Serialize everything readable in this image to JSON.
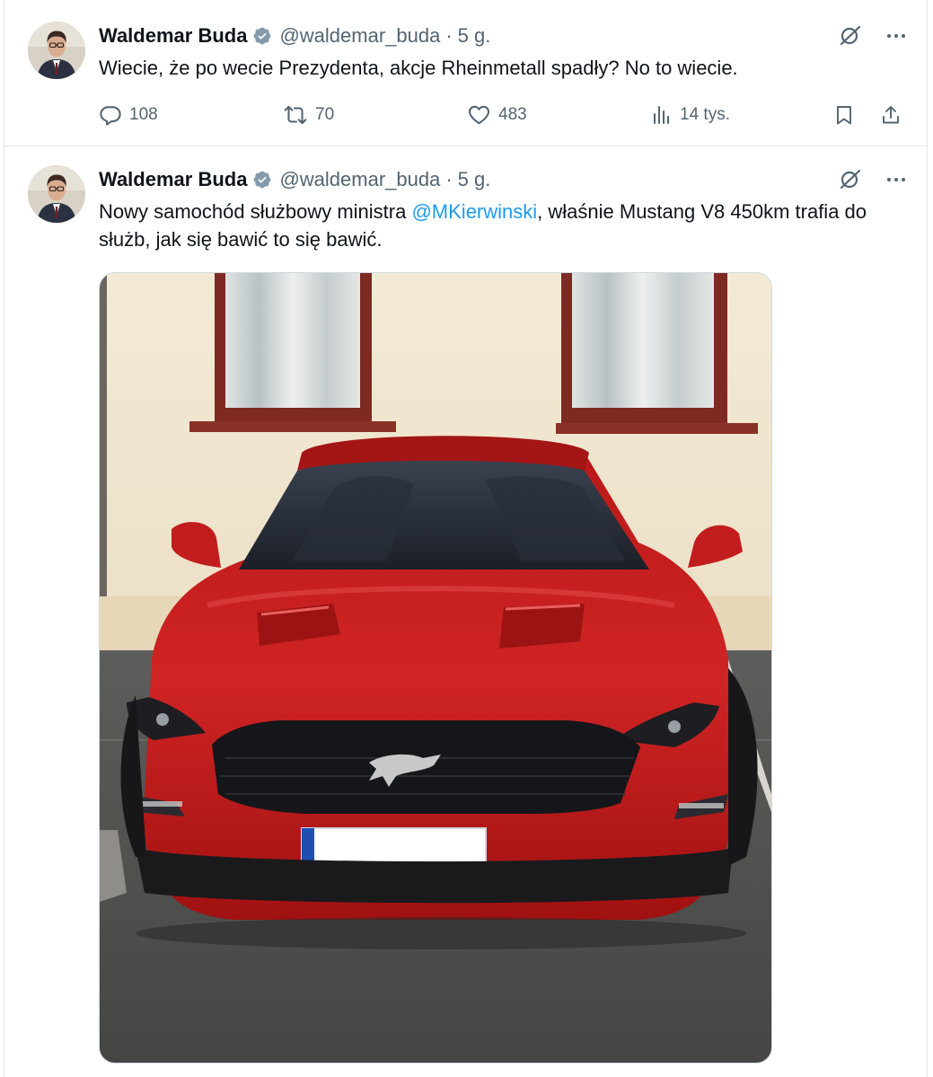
{
  "tweets": [
    {
      "author_name": "Waldemar Buda",
      "handle": "@waldemar_buda",
      "separator": "·",
      "time": "5 g.",
      "text": "Wiecie, że po wecie Prezydenta, akcje Rheinmetall spadły? No to wiecie.",
      "stats": {
        "replies": "108",
        "retweets": "70",
        "likes": "483",
        "views": "14 tys."
      }
    },
    {
      "author_name": "Waldemar Buda",
      "handle": "@waldemar_buda",
      "separator": "·",
      "time": "5 g.",
      "text_before": "Nowy samochód służbowy ministra ",
      "mention": "@MKierwinski",
      "text_after": ", właśnie Mustang V8 450km trafia do służb, jak się bawić to się bawić.",
      "media_kind": "photo"
    }
  ],
  "colors": {
    "text": "#0f1419",
    "secondary": "#536471",
    "link": "#1d9bf0",
    "verified": "#829aab",
    "border": "#e1e6ea",
    "car": "#c51d1d"
  },
  "icons": {
    "verified": "verified-badge-icon",
    "grok": "grok-icon",
    "more": "more-options-icon",
    "reply": "reply-icon",
    "retweet": "retweet-icon",
    "like": "like-icon",
    "views": "views-icon",
    "bookmark": "bookmark-icon",
    "share": "share-icon"
  }
}
